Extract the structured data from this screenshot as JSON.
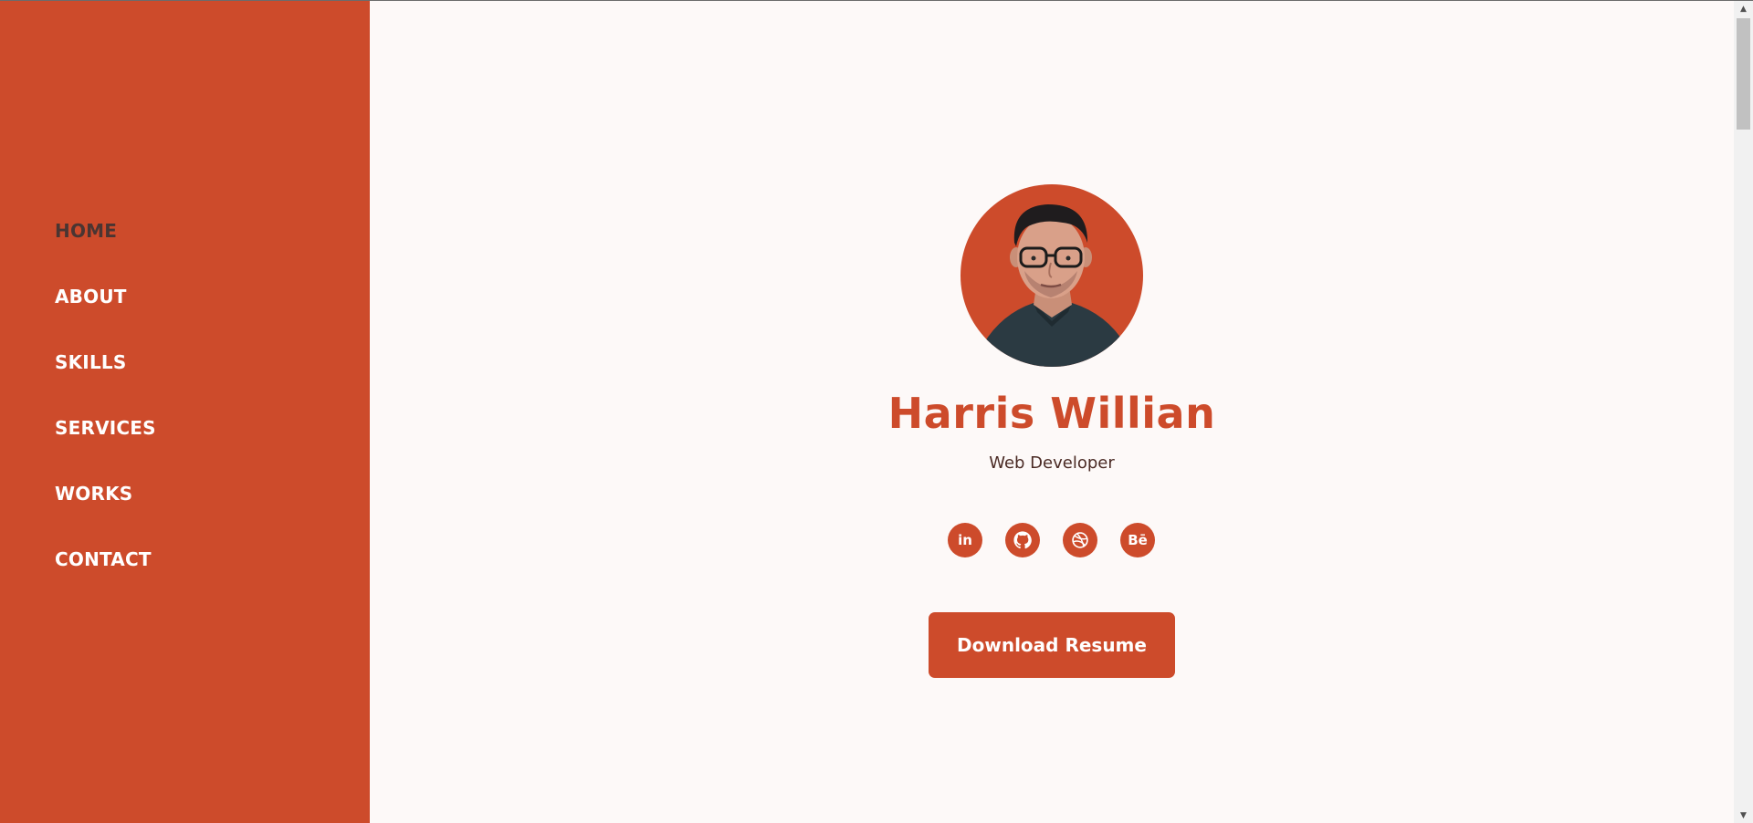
{
  "nav": {
    "items": [
      {
        "label": "HOME",
        "active": true
      },
      {
        "label": "ABOUT"
      },
      {
        "label": "SKILLS"
      },
      {
        "label": "SERVICES"
      },
      {
        "label": "WORKS"
      },
      {
        "label": "CONTACT"
      }
    ]
  },
  "hero": {
    "name": "Harris Willian",
    "role": "Web Developer",
    "avatar_icon": "profile-photo",
    "socials": [
      {
        "icon": "linkedin-icon",
        "text": "in"
      },
      {
        "icon": "github-icon"
      },
      {
        "icon": "dribbble-icon"
      },
      {
        "icon": "behance-icon",
        "text": "Bē"
      }
    ],
    "download_label": "Download Resume"
  },
  "colors": {
    "accent": "#cd4b2b",
    "background": "#fdf9f8",
    "nav_active": "#4a3532",
    "role_text": "#4a2a24"
  }
}
